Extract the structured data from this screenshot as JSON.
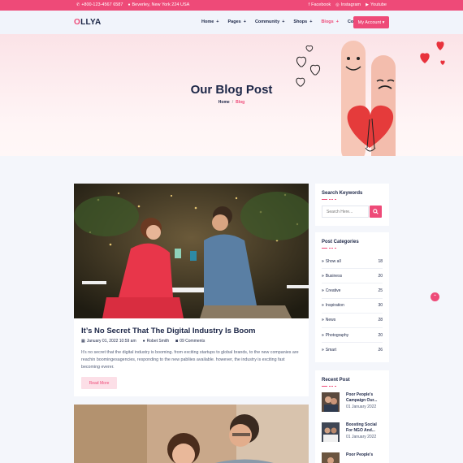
{
  "topbar": {
    "phone": "+800-123-4567 6587",
    "address": "Beverley, New York 224 USA",
    "social": [
      "Facebook",
      "Instagram",
      "Youtube"
    ]
  },
  "header": {
    "logo_first": "O",
    "logo_rest": "LLYA",
    "nav": [
      {
        "label": "Home",
        "plus": "+"
      },
      {
        "label": "Pages",
        "plus": "+"
      },
      {
        "label": "Community",
        "plus": "+"
      },
      {
        "label": "Shops",
        "plus": "+"
      },
      {
        "label": "Blogs",
        "plus": "+"
      },
      {
        "label": "Contact",
        "plus": ""
      }
    ],
    "account_btn": "My Account ▾"
  },
  "hero": {
    "title": "Our Blog Post",
    "crumb_home": "Home",
    "crumb_sep": "/",
    "crumb_current": "Blog"
  },
  "post": {
    "title": "It’s No Secret That The Digital Industry Is Boom",
    "date": "January 01, 2022 10:59 am",
    "author": "Robet Smith",
    "comments": "09 Comments",
    "excerpt": "It’s no secret that the digital industry is booming. from exciting startups to global brands, to the new companies are reachin boomingesagencies, responding to the new pabliies available. however, the industry is exciting fast becoming everer.",
    "read_more": "Read More"
  },
  "sidebar": {
    "search_title": "Search Keywords",
    "search_placeholder": "Search Here...",
    "categories_title": "Post Categories",
    "categories": [
      {
        "name": "Show all",
        "count": "18"
      },
      {
        "name": "Business",
        "count": "20"
      },
      {
        "name": "Creative",
        "count": "25"
      },
      {
        "name": "Inspiration",
        "count": "30"
      },
      {
        "name": "News",
        "count": "28"
      },
      {
        "name": "Photography",
        "count": "20"
      },
      {
        "name": "Smart",
        "count": "26"
      }
    ],
    "recent_title": "Recent Post",
    "recent": [
      {
        "title": "Poor People’s Campaign Our...",
        "date": "01 January 2022"
      },
      {
        "title": "Boosting Social For NGO And...",
        "date": "01 January 2022"
      },
      {
        "title": "Poor People’s",
        "date": ""
      }
    ]
  },
  "colors": {
    "accent": "#ee4a78",
    "navy": "#1c2647"
  }
}
